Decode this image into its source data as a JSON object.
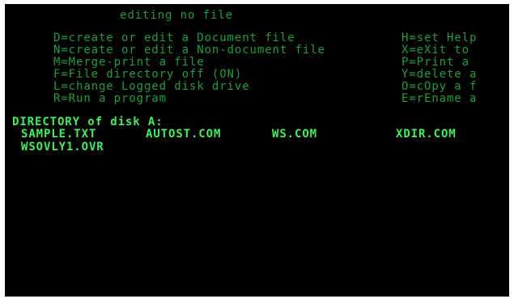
{
  "title": "editing no file",
  "menu_left": [
    "D=create or edit a Document file",
    "N=create or edit a Non-document file",
    "M=Merge-print a file",
    "F=File directory off (ON)",
    "L=change Logged disk drive",
    "R=Run a program"
  ],
  "menu_right": [
    "H=set Help",
    "X=eXit to",
    "P=Print a",
    "Y=delete a",
    "O=cOpy a f",
    "E=rEname a"
  ],
  "directory": {
    "heading": "DIRECTORY of disk A:",
    "files": [
      "SAMPLE.TXT",
      "AUTOST.COM",
      "WS.COM",
      "XDIR.COM",
      "WSOVLY1.OVR"
    ]
  },
  "colors": {
    "background": "#000000",
    "text": "#1e9e3a",
    "highlight": "#3ef05a"
  }
}
